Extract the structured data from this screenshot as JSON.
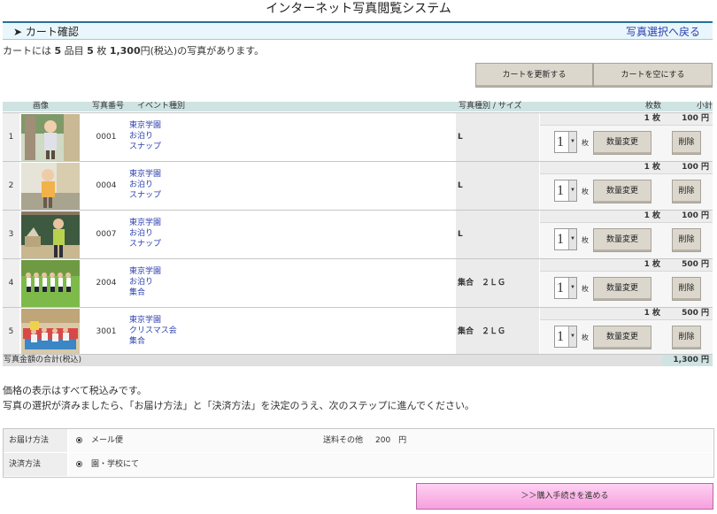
{
  "page": {
    "title": "インターネット写真閲覧システム",
    "cart_heading": "カート確認",
    "back_link": "写真選択へ戻る"
  },
  "summary": {
    "prefix": "カートには",
    "items": "5",
    "items_unit": "品目",
    "count": "5",
    "count_unit": "枚",
    "amount": "1,300",
    "suffix": "円(税込)の写真があります。"
  },
  "buttons": {
    "update": "カートを更新する",
    "empty": "カートを空にする",
    "change": "数量変更",
    "delete": "削除",
    "proceed": "＞＞購入手続きを進める"
  },
  "table": {
    "headers": {
      "image": "画像",
      "photo_no": "写真番号",
      "event": "イベント種別",
      "type_size": "写真種別 / サイズ",
      "qty": "枚数",
      "subtotal": "小計"
    },
    "qty_unit": "枚",
    "rows": [
      {
        "no": "1",
        "photo_id": "0001",
        "event": [
          "東京学園",
          "お泊り",
          "スナップ"
        ],
        "type": "L",
        "qty": "1 枚",
        "select": "1",
        "subtotal": "100 円",
        "img": "child-portrait-1"
      },
      {
        "no": "2",
        "photo_id": "0004",
        "event": [
          "東京学園",
          "お泊り",
          "スナップ"
        ],
        "type": "L",
        "qty": "1 枚",
        "select": "1",
        "subtotal": "100 円",
        "img": "child-portrait-2"
      },
      {
        "no": "3",
        "photo_id": "0007",
        "event": [
          "東京学園",
          "お泊り",
          "スナップ"
        ],
        "type": "L",
        "qty": "1 枚",
        "select": "1",
        "subtotal": "100 円",
        "img": "classroom-teacher"
      },
      {
        "no": "4",
        "photo_id": "2004",
        "event": [
          "東京学園",
          "お泊り",
          "集合"
        ],
        "type": "集合　２ＬＧ",
        "qty": "1 枚",
        "select": "1",
        "subtotal": "500 円",
        "img": "group-on-grass"
      },
      {
        "no": "5",
        "photo_id": "3001",
        "event": [
          "東京学園",
          "クリスマス会",
          "集合"
        ],
        "type": "集合　２ＬＧ",
        "qty": "1 枚",
        "select": "1",
        "subtotal": "500 円",
        "img": "group-christmas"
      }
    ],
    "total_label": "写真金額の合計(税込)",
    "total_value": "1,300 円"
  },
  "notes": [
    "価格の表示はすべて税込みです。",
    "写真の選択が済みましたら、「お届け方法」と「決済方法」を決定のうえ、次のステップに進んでください。"
  ],
  "options": {
    "delivery_label": "お届け方法",
    "delivery_value": "メール便",
    "shipping_label": "送料その他",
    "shipping_value": "200　円",
    "payment_label": "決済方法",
    "payment_value": "園・学校にて"
  }
}
